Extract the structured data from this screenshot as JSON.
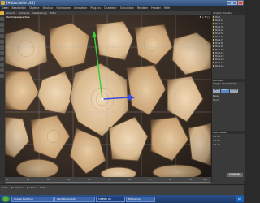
{
  "window": {
    "title": "[Holzscheite.c4d]"
  },
  "menubar": {
    "items": [
      "Datei",
      "Bearbeiten",
      "Objekte",
      "Struktur",
      "Funktionen",
      "Animation",
      "Plug-ins",
      "Charakter",
      "Simulation",
      "Rendern",
      "Fenster",
      "Hilfe"
    ]
  },
  "viewport": {
    "menu": [
      "Ansicht",
      "Kameras",
      "Darstellung",
      "Filter"
    ],
    "label": "Zentralperspektive"
  },
  "right_panel": {
    "tabs": [
      "Objekte",
      "Struktur"
    ],
    "objects": [
      "Holz",
      "Holz.1",
      "Holz.2",
      "Holz.3",
      "Holz.4",
      "Holz.5",
      "Holz.6",
      "Holz.7",
      "Holz.8",
      "Holz.9",
      "Holz.10",
      "Holz.11",
      "Holz.12",
      "Holz.13",
      "Holz.14",
      "Holz.15"
    ],
    "attributes_header": "Attribute",
    "attr_rows": [
      "Polygon-Objekt [Holz]",
      "Basis",
      "Koord."
    ],
    "attr_tabs": [
      "Basis",
      "Koord.",
      "Phong"
    ],
    "coords_header": "Koordinaten",
    "coord_rows": [
      "X 0 cm",
      "Y 0 cm",
      "Z 0 cm"
    ],
    "apply_label": "Anwenden"
  },
  "timeline": {
    "ticks": [
      "0",
      "10",
      "20",
      "30",
      "40",
      "50",
      "60",
      "70",
      "80",
      "90",
      "100"
    ]
  },
  "materials": {
    "menu": [
      "Datei",
      "Bearbeiten",
      "Funktion",
      "Textur"
    ]
  },
  "taskbar": {
    "tasks": [
      "Google Sketchup",
      "Word Dokument",
      "CINEMA 4D",
      "Photoshop"
    ],
    "active_task": "CINEMA 4D",
    "tray_text": "DE"
  },
  "colors": {
    "title_bar": "#2f4f7c",
    "selection": "#e0b040",
    "accent_blue": "#5c88c8"
  }
}
